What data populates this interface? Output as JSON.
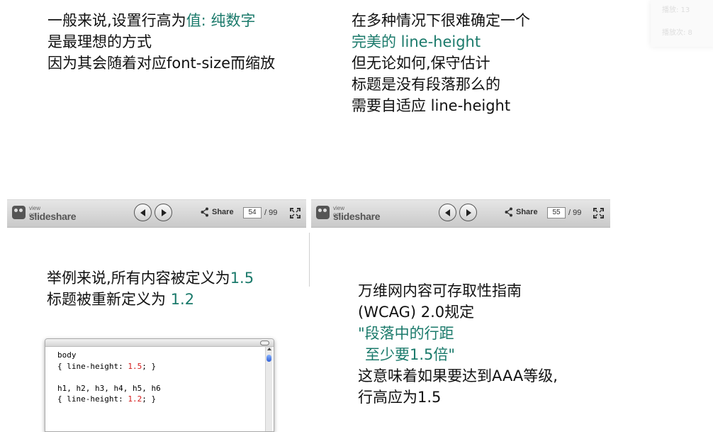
{
  "slide54": {
    "line1": "一般来说,设置行高为",
    "line1_accent": "值: 纯数字",
    "line2": "是最理想的方式",
    "line3": "因为其会随着对应font-size而缩放"
  },
  "slide55": {
    "line1": "在多种情况下很难确定一个",
    "line2_accent": "完美的 line-height",
    "line3": "但无论如何,保守估计",
    "line4": "标题是没有段落那么的",
    "line5": "需要自适应 line-height"
  },
  "toolbar_left": {
    "logo_small": "view on",
    "logo_big": "slideshare",
    "share_label": "Share",
    "page_current": "54",
    "page_total": "/ 99"
  },
  "toolbar_right": {
    "logo_small": "view on",
    "logo_big": "slideshare",
    "share_label": "Share",
    "page_current": "55",
    "page_total": "/ 99"
  },
  "slide_lower_left": {
    "line1": "举例来说,所有内容被定义为",
    "line1_accent": "1.5",
    "line2": "标题被重新定义为",
    "line2_accent": "1.2"
  },
  "code": {
    "l1": "body",
    "l2_pre": "{ line-height: ",
    "l2_num": "1.5",
    "l2_post": "; }",
    "l4": "h1, h2, h3, h4, h5, h6",
    "l5_pre": "{ line-height: ",
    "l5_num": "1.2",
    "l5_post": "; }"
  },
  "slide_lower_right": {
    "line1": "万维网内容可存取性指南",
    "line2": "(WCAG) 2.0规定",
    "line3_accent": "\"段落中的行距",
    "line4_accent": "至少要1.5倍\"",
    "line5": "这意味着如果要达到AAA等级,",
    "line6": "行高应为1.5"
  },
  "corner": {
    "line1": "播放: 13",
    "line2": "播放次: 8"
  },
  "colors": {
    "accent": "#1b7a6b",
    "code_number": "#d41a1a",
    "toolbar_bg": "#d6d6d6"
  },
  "icons": [
    "slideshare-logo-icon",
    "previous-icon",
    "next-icon",
    "share-icon",
    "fullscreen-icon"
  ]
}
